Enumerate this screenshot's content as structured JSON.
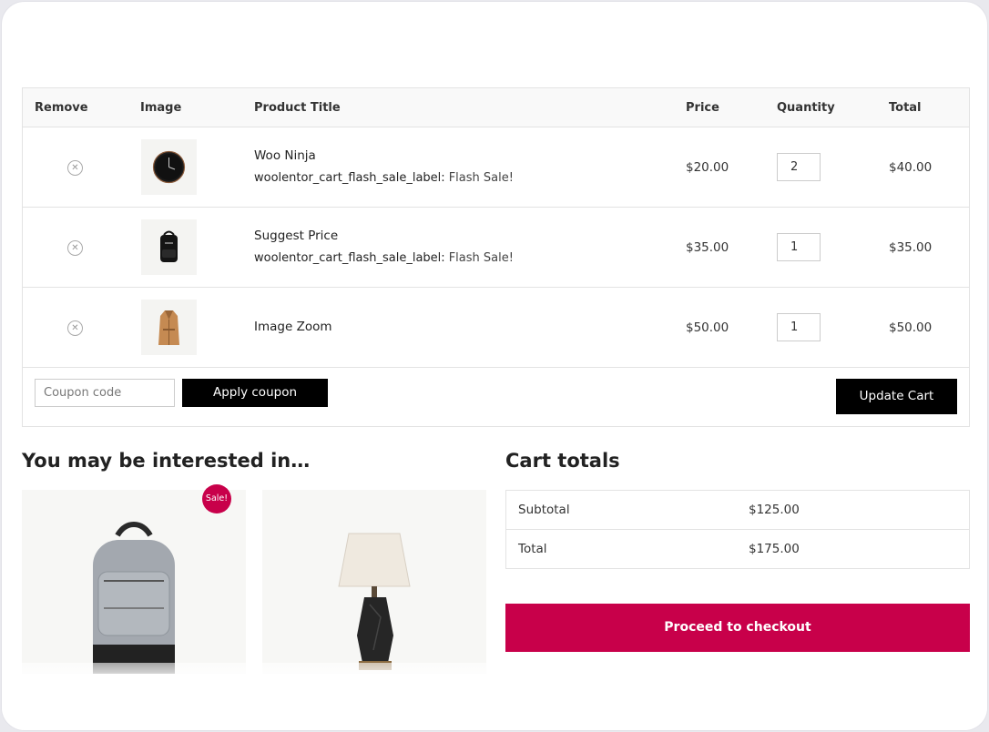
{
  "cart": {
    "headers": {
      "remove": "Remove",
      "image": "Image",
      "title": "Product Title",
      "price": "Price",
      "quantity": "Quantity",
      "total": "Total"
    },
    "rows": [
      {
        "title": "Woo Ninja",
        "meta_key": "woolentor_cart_flash_sale_label:",
        "meta_value": "Flash Sale!",
        "price": "$20.00",
        "quantity": "2",
        "total": "$40.00",
        "image_icon": "clock-icon"
      },
      {
        "title": "Suggest Price",
        "meta_key": "woolentor_cart_flash_sale_label:",
        "meta_value": "Flash Sale!",
        "price": "$35.00",
        "quantity": "1",
        "total": "$35.00",
        "image_icon": "backpack-icon"
      },
      {
        "title": "Image Zoom",
        "price": "$50.00",
        "quantity": "1",
        "total": "$50.00",
        "image_icon": "coat-icon"
      }
    ],
    "remove_symbol": "✕",
    "coupon_placeholder": "Coupon code",
    "apply_coupon_label": "Apply coupon",
    "update_cart_label": "Update Cart"
  },
  "interested": {
    "title": "You may be interested in…",
    "sale_badge": "Sale!"
  },
  "totals": {
    "title": "Cart totals",
    "subtotal_label": "Subtotal",
    "subtotal_value": "$125.00",
    "total_label": "Total",
    "total_value": "$175.00",
    "checkout_label": "Proceed to checkout"
  },
  "colors": {
    "accent": "#c8004a",
    "button_dark": "#000000"
  }
}
